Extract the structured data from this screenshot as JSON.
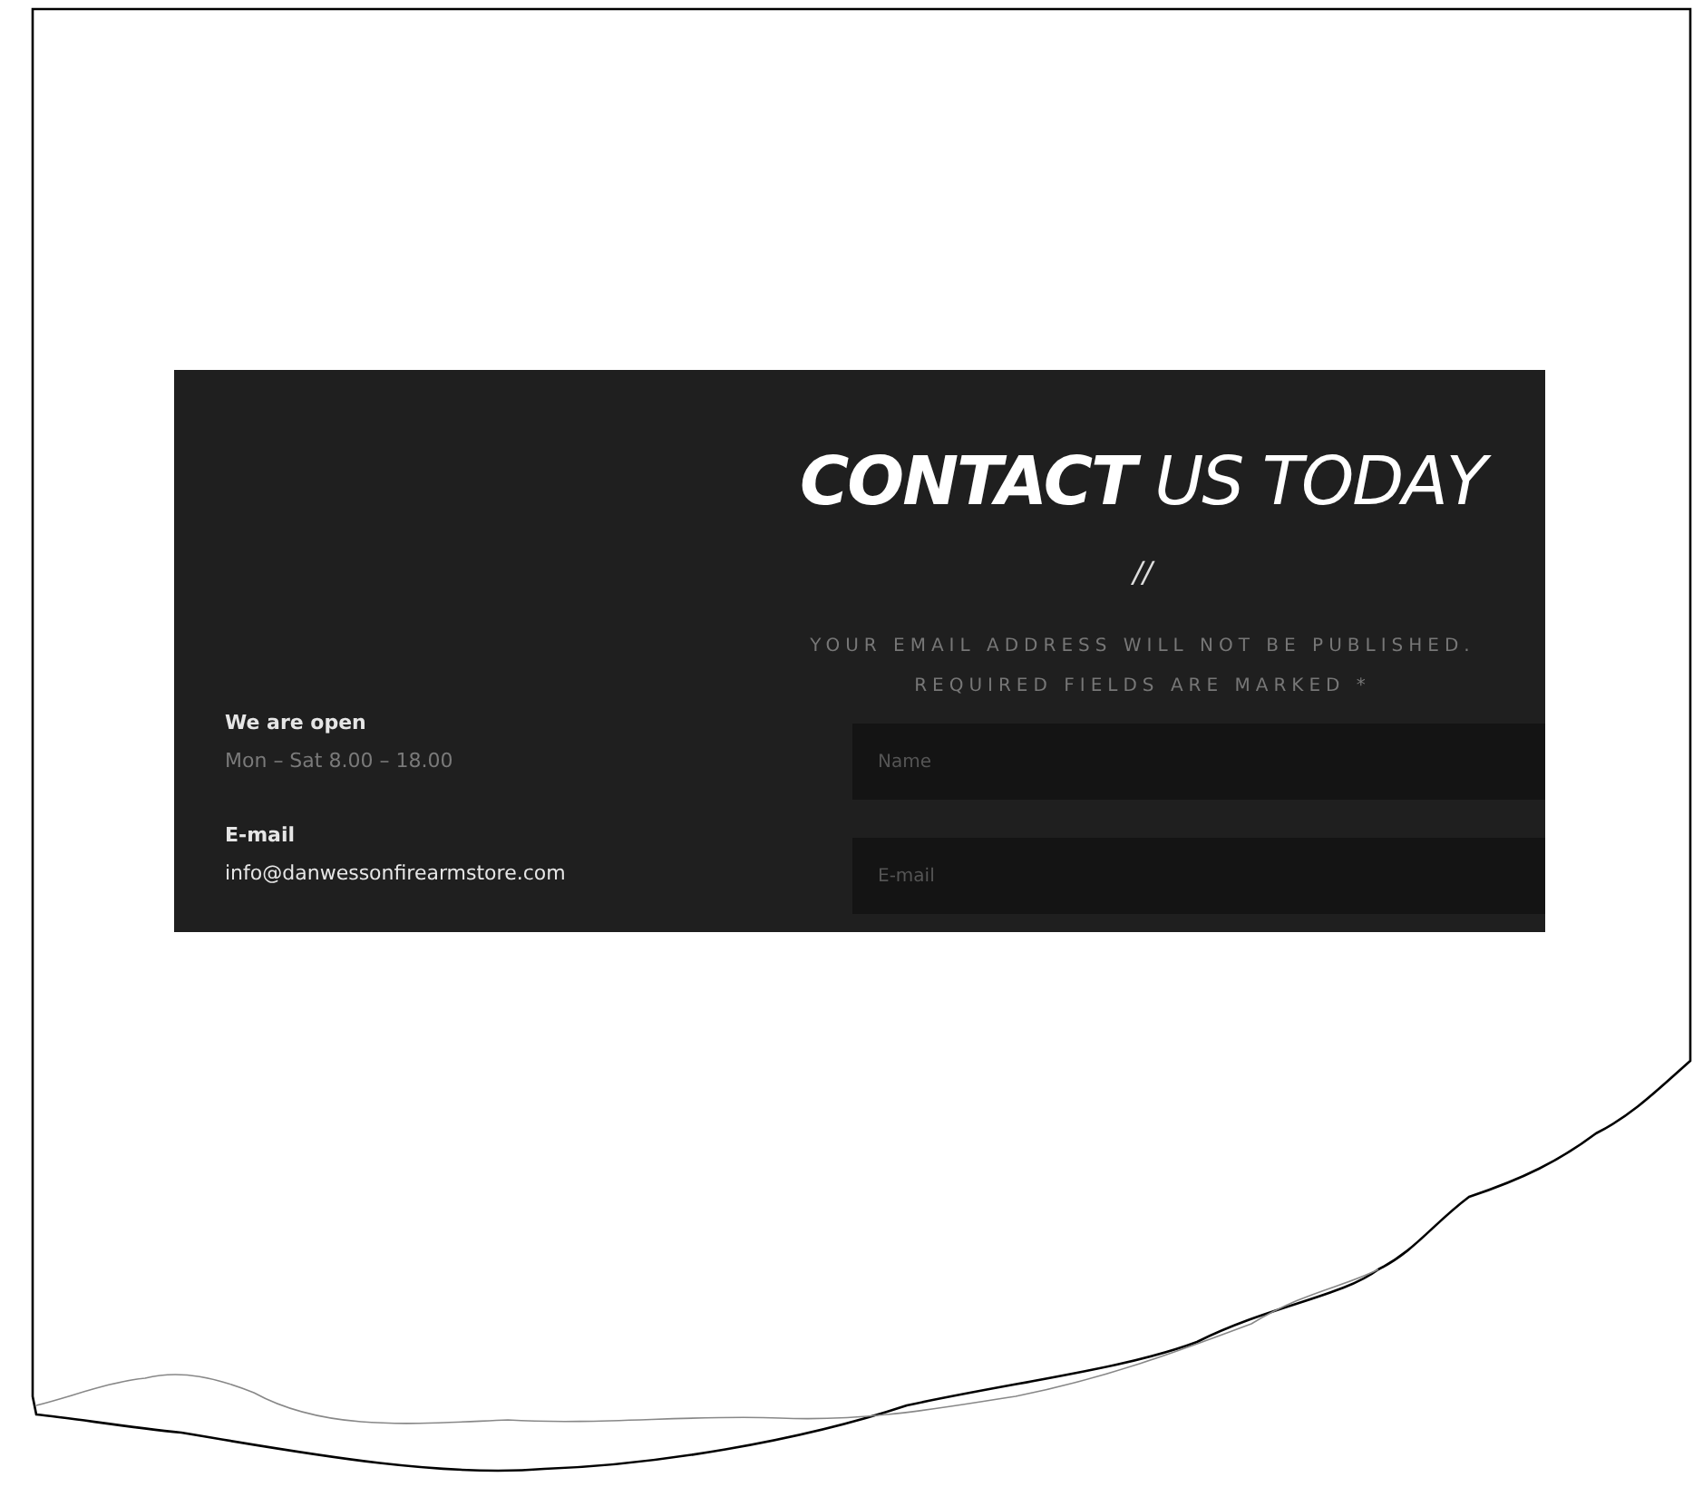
{
  "contact_info": [
    {
      "label": "We are open",
      "value": "Mon – Sat 8.00 – 18.00",
      "kind": "muted"
    },
    {
      "label": "E-mail",
      "value": "info@danwessonfirearmstore.com",
      "kind": "bright"
    }
  ],
  "form": {
    "title": "**CONTACT** US TODAY",
    "divider": "//",
    "notice": [
      "YOUR EMAIL ADDRESS WILL NOT BE PUBLISHED.",
      "REQUIRED FIELDS ARE MARKED *"
    ],
    "fields": [
      {
        "placeholder": "Name"
      },
      {
        "placeholder": "E-mail"
      }
    ]
  }
}
